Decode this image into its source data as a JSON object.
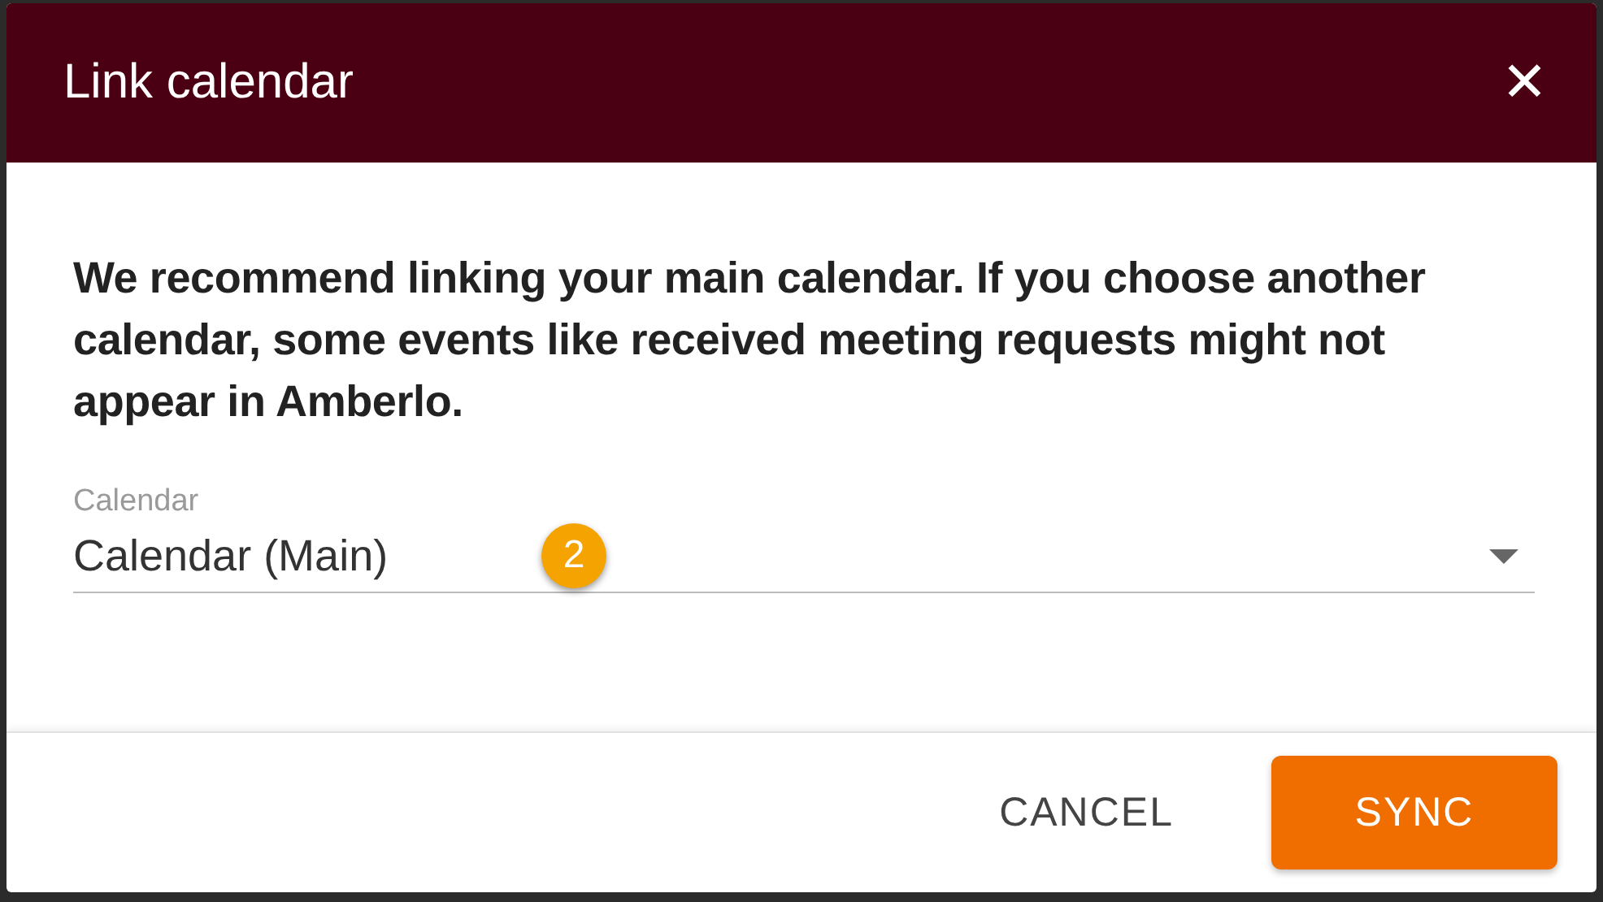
{
  "dialog": {
    "title": "Link calendar",
    "close_icon": "✕"
  },
  "message": "We recommend linking your main calendar. If you choose another calendar, some events like received meeting requests might not appear in Amberlo.",
  "calendar_field": {
    "label": "Calendar",
    "value": "Calendar (Main)"
  },
  "annotation_badge": "2",
  "buttons": [
    {
      "label": "CANCEL",
      "kind": "text"
    },
    {
      "label": "SYNC",
      "kind": "primary"
    }
  ]
}
